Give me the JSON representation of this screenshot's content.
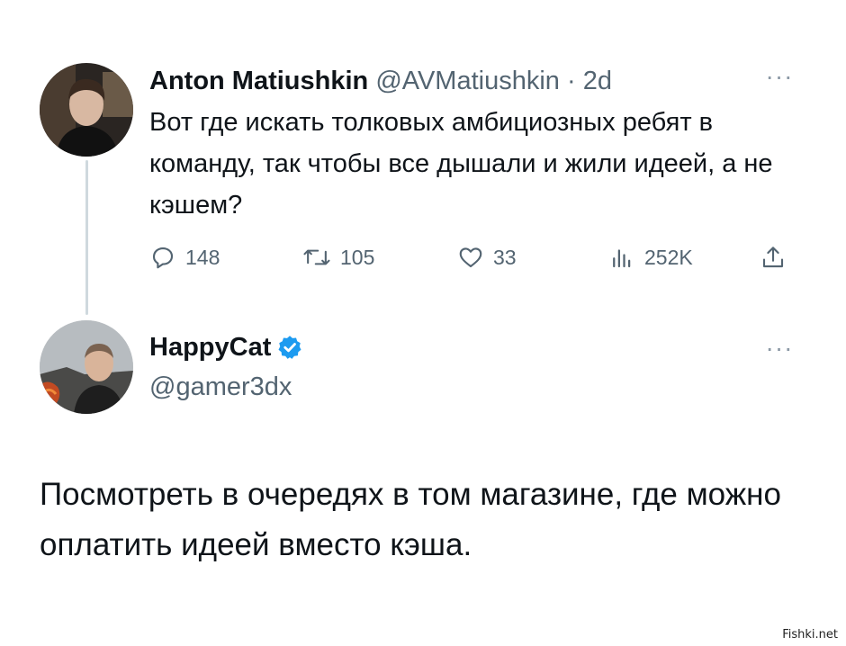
{
  "tweet": {
    "author_name": "Anton Matiushkin",
    "author_handle": "@AVMatiushkin",
    "separator": "·",
    "time": "2d",
    "more_icon": "more-horizontal-icon",
    "text": "Вот где искать толковых амбициозных ребят в команду, так чтобы все дышали и жили идеей, а не кэшем?",
    "actions": {
      "replies": "148",
      "retweets": "105",
      "likes": "33",
      "views": "252K"
    }
  },
  "reply": {
    "author_name": "HappyCat",
    "verified": true,
    "verified_color": "#1d9bf0",
    "author_handle": "@gamer3dx",
    "more_icon": "more-horizontal-icon",
    "text": "Посмотреть в очередях в том магазине, где можно оплатить идеей вместо кэша."
  },
  "watermark": "Fishki.net",
  "colors": {
    "text": "#0f1419",
    "secondary": "#536471",
    "thread_line": "#cfd9de"
  }
}
